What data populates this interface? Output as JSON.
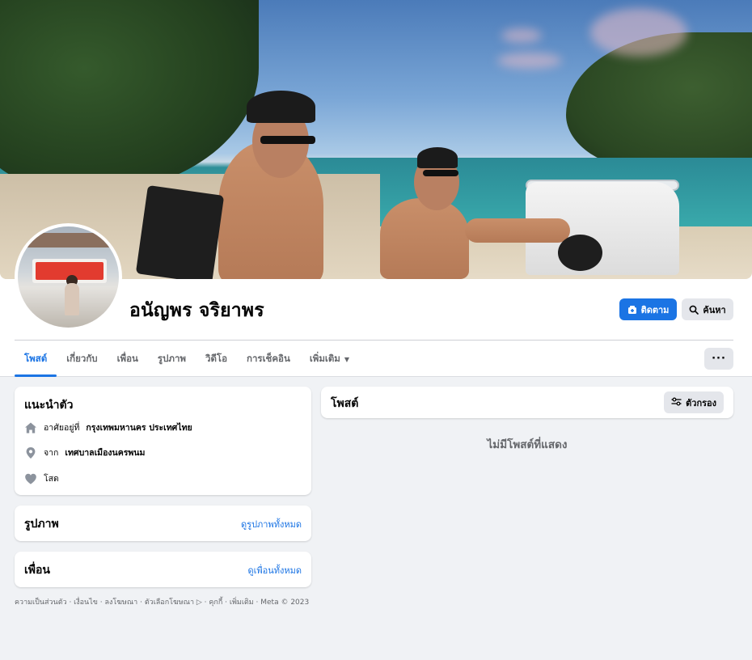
{
  "profile": {
    "name": "อนัญพร จริยาพร",
    "follow_label": "ติดตาม",
    "search_label": "ค้นหา"
  },
  "tabs": [
    {
      "label": "โพสต์",
      "active": true
    },
    {
      "label": "เกี่ยวกับ"
    },
    {
      "label": "เพื่อน"
    },
    {
      "label": "รูปภาพ"
    },
    {
      "label": "วิดีโอ"
    },
    {
      "label": "การเช็คอิน"
    },
    {
      "label": "เพิ่มเติม"
    }
  ],
  "more_label": "···",
  "intro": {
    "title": "แนะนำตัว",
    "lives_prefix": "อาศัยอยู่ที่",
    "lives_value": "กรุงเทพมหานคร ประเทศไทย",
    "from_prefix": "จาก",
    "from_value": "เทศบาลเมืองนครพนม",
    "relationship": "โสด"
  },
  "photos": {
    "title": "รูปภาพ",
    "link": "ดูรูปภาพทั้งหมด"
  },
  "friends": {
    "title": "เพื่อน",
    "link": "ดูเพื่อนทั้งหมด"
  },
  "footer": "ความเป็นส่วนตัว · เงื่อนไข · ลงโฆษณา · ตัวเลือกโฆษณา ▷ · คุกกี้ · เพิ่มเติม · Meta © 2023",
  "posts": {
    "title": "โพสต์",
    "filter_label": "ตัวกรอง",
    "empty": "ไม่มีโพสต์ที่แสดง"
  },
  "colors": {
    "accent": "#1b74e4",
    "page_bg": "#f0f2f5",
    "secondary_text": "#65676b"
  },
  "icons": [
    "follow-icon",
    "search-icon",
    "home-icon",
    "location-icon",
    "heart-icon",
    "filter-icon",
    "caret-down-icon"
  ]
}
